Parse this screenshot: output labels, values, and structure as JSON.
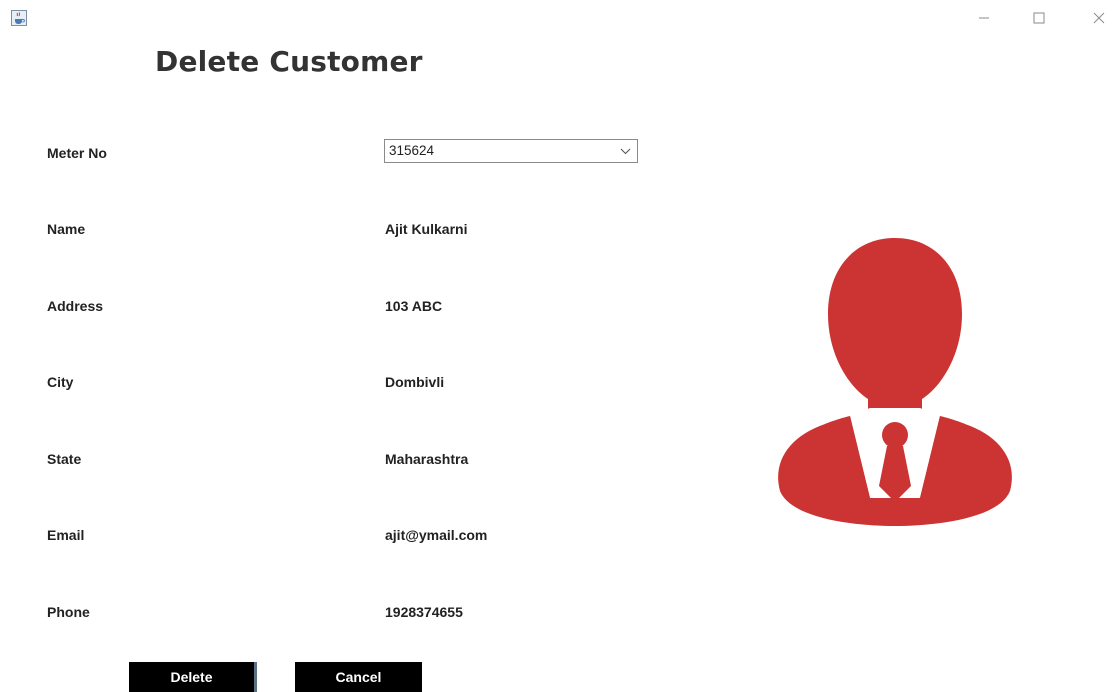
{
  "window": {
    "app_icon": "java-cup-icon",
    "controls": [
      "minimize-icon",
      "maximize-icon",
      "close-icon"
    ]
  },
  "page": {
    "title": "Delete Customer"
  },
  "form": {
    "meter": {
      "label": "Meter No",
      "selected": "315624"
    },
    "fields": [
      {
        "label": "Name",
        "value": "Ajit Kulkarni"
      },
      {
        "label": "Address",
        "value": "103 ABC"
      },
      {
        "label": "City",
        "value": "Dombivli"
      },
      {
        "label": "State",
        "value": "Maharashtra"
      },
      {
        "label": "Email",
        "value": "ajit@ymail.com"
      },
      {
        "label": "Phone",
        "value": "1928374655"
      }
    ]
  },
  "buttons": {
    "delete_label": "Delete",
    "cancel_label": "Cancel"
  },
  "colors": {
    "avatar": "#cc3333",
    "button_bg": "#000000",
    "button_text": "#ffffff"
  },
  "avatar_icon": "customer-avatar-icon"
}
